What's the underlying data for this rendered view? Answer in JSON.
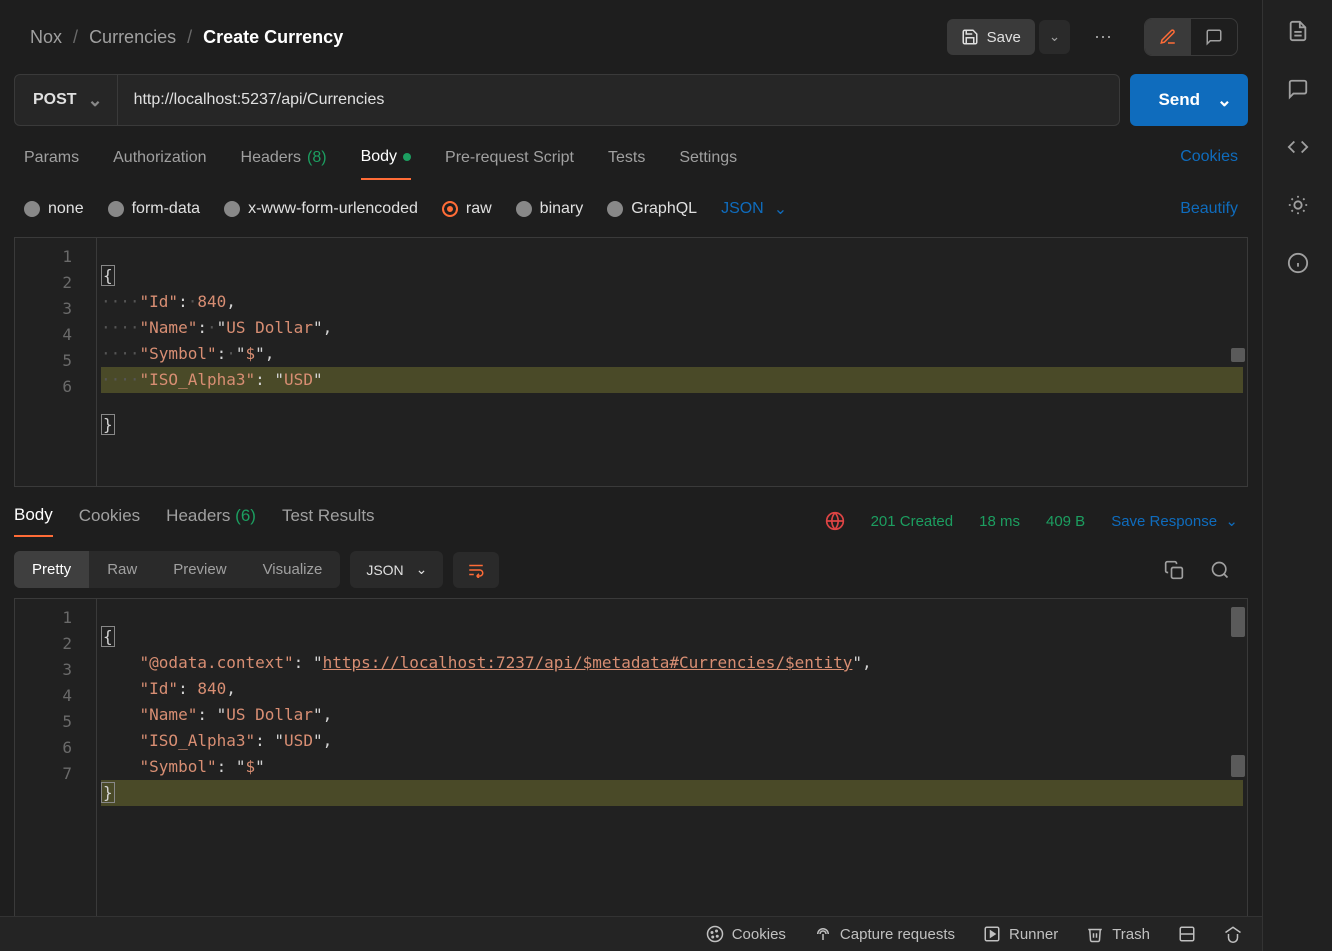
{
  "breadcrumb": {
    "a": "Nox",
    "b": "Currencies",
    "c": "Create Currency"
  },
  "header": {
    "save": "Save"
  },
  "request": {
    "method": "POST",
    "url": "http://localhost:5237/api/Currencies",
    "send": "Send",
    "tabs": {
      "params": "Params",
      "authorization": "Authorization",
      "headers": "Headers",
      "headers_count": "(8)",
      "body": "Body",
      "prerequest": "Pre-request Script",
      "tests": "Tests",
      "settings": "Settings",
      "cookies": "Cookies"
    },
    "body_types": {
      "none": "none",
      "formdata": "form-data",
      "urlencoded": "x-www-form-urlencoded",
      "raw": "raw",
      "binary": "binary",
      "graphql": "GraphQL",
      "subtype": "JSON",
      "beautify": "Beautify"
    },
    "body_lines": [
      "1",
      "2",
      "3",
      "4",
      "5",
      "6"
    ],
    "body_json": {
      "Id": 840,
      "Name": "US Dollar",
      "Symbol": "$",
      "ISO_Alpha3": "USD"
    }
  },
  "response": {
    "tabs": {
      "body": "Body",
      "cookies": "Cookies",
      "headers": "Headers",
      "headers_count": "(6)",
      "tests": "Test Results"
    },
    "status": "201 Created",
    "time": "18 ms",
    "size": "409 B",
    "save": "Save Response",
    "views": {
      "pretty": "Pretty",
      "raw": "Raw",
      "preview": "Preview",
      "visualize": "Visualize"
    },
    "format": "JSON",
    "body_lines": [
      "1",
      "2",
      "3",
      "4",
      "5",
      "6",
      "7"
    ],
    "body_json": {
      "@odata.context": "https://localhost:7237/api/$metadata#Currencies/$entity",
      "Id": 840,
      "Name": "US Dollar",
      "ISO_Alpha3": "USD",
      "Symbol": "$"
    }
  },
  "footer": {
    "cookies": "Cookies",
    "capture": "Capture requests",
    "runner": "Runner",
    "trash": "Trash"
  }
}
